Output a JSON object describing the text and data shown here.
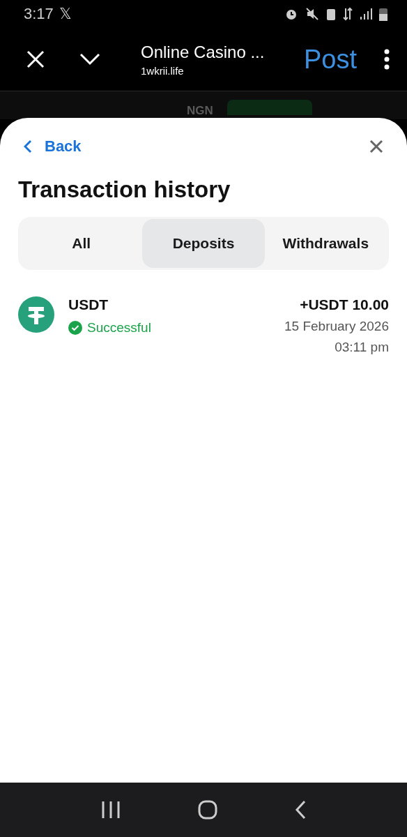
{
  "status_bar": {
    "time": "3:17",
    "notification": "𝕏"
  },
  "browser": {
    "title": "Online Casino ...",
    "url": "1wkrii.life",
    "action": "Post"
  },
  "background_page": {
    "currency": "NGN"
  },
  "sheet": {
    "back": "Back",
    "title": "Transaction history",
    "tabs": [
      {
        "label": "All",
        "selected": false
      },
      {
        "label": "Deposits",
        "selected": true
      },
      {
        "label": "Withdrawals",
        "selected": false
      }
    ],
    "transactions": [
      {
        "currency": "USDT",
        "status": "Successful",
        "kind": "success",
        "amount": "+USDT 10.00",
        "date": "15 February 2026",
        "time": "03:11 pm"
      }
    ]
  }
}
